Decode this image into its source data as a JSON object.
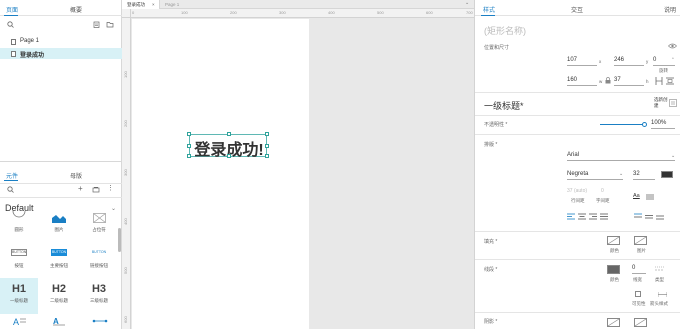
{
  "left_panel": {
    "top_tabs": [
      "页面",
      "概要"
    ],
    "pages": [
      "Page 1",
      "登录成功"
    ],
    "bottom_tabs": [
      "元件",
      "母版"
    ],
    "library": "Default",
    "widgets_row1": [
      "圆形",
      "图片",
      "占位符"
    ],
    "widgets_row2": [
      "按钮",
      "主要按钮",
      "链接按钮"
    ],
    "button_texts": [
      "BUTTON",
      "BUTTON",
      "BUTTON"
    ],
    "widgets_row3_glyphs": [
      "H1",
      "H2",
      "H3"
    ],
    "widgets_row3": [
      "一级标题",
      "二级标题",
      "三级标题"
    ]
  },
  "canvas": {
    "doc_tabs": [
      "登录成功",
      "Page 1"
    ],
    "ruler_top": [
      "0",
      "100",
      "200",
      "300",
      "400",
      "500",
      "600",
      "700"
    ],
    "ruler_left": [
      "100",
      "200",
      "300",
      "400",
      "500",
      "600",
      "700"
    ],
    "heading_text": "登录成功!"
  },
  "right_panel": {
    "tabs": [
      "样式",
      "交互",
      "说明"
    ],
    "shape_name_placeholder": "(矩形名称)",
    "position_size_label": "位置和尺寸",
    "x": "107",
    "x_unit": "x",
    "y": "246",
    "y_unit": "y",
    "rotation": "0",
    "rotation_label": "旋转",
    "rotation_unit": "°",
    "w": "160",
    "w_unit": "w",
    "h": "37",
    "h_unit": "h",
    "style_name": "一级标题*",
    "select_create": "选新创建",
    "opacity_label": "不透明性 *",
    "opacity_value": "100%",
    "opacity_fraction": 1.0,
    "font_label": "排版 *",
    "font_family": "Arial",
    "font_style": "Negreta",
    "font_size": "32",
    "line_height_placeholder": "37 (auto)",
    "char_spacing_placeholder": "0",
    "line_height_label": "行间距",
    "char_spacing_label": "字间距",
    "fill_label": "填充 *",
    "fill_color_label": "颜色",
    "fill_image_label": "图片",
    "border_label": "线段 *",
    "border_color_label": "颜色",
    "border_thickness": "0",
    "border_thickness_label": "线宽",
    "border_type_label": "类型",
    "visibility_label": "可见性",
    "arrow_label": "箭头样式",
    "shadow_label": "阴影 *",
    "text_color": "#333333"
  }
}
